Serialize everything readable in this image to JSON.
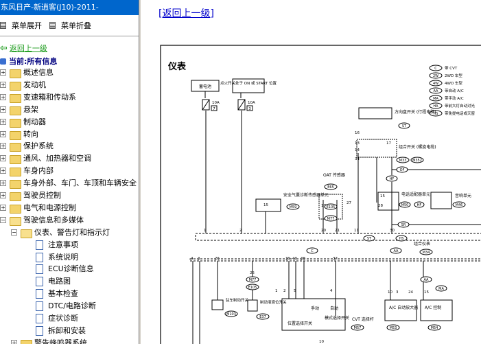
{
  "left_panel": {
    "title": "东风日产-新逍客(J10)-2011-",
    "menu": {
      "expand_label": "菜单展开",
      "collapse_label": "菜单折叠"
    },
    "back_label": "返回上一级",
    "current_label": "当前:所有信息",
    "tree": [
      {
        "label": "概述信息",
        "level": 0,
        "type": "folder"
      },
      {
        "label": "发动机",
        "level": 0,
        "type": "folder"
      },
      {
        "label": "变速箱和传动系",
        "level": 0,
        "type": "folder"
      },
      {
        "label": "悬架",
        "level": 0,
        "type": "folder"
      },
      {
        "label": "制动器",
        "level": 0,
        "type": "folder"
      },
      {
        "label": "转向",
        "level": 0,
        "type": "folder"
      },
      {
        "label": "保护系统",
        "level": 0,
        "type": "folder"
      },
      {
        "label": "通风、加热器和空调",
        "level": 0,
        "type": "folder"
      },
      {
        "label": "车身内部",
        "level": 0,
        "type": "folder"
      },
      {
        "label": "车身外部、车门、车顶和车辆安全",
        "level": 0,
        "type": "folder"
      },
      {
        "label": "驾驶员控制",
        "level": 0,
        "type": "folder"
      },
      {
        "label": "电气和电源控制",
        "level": 0,
        "type": "folder"
      },
      {
        "label": "驾驶信息和多媒体",
        "level": 0,
        "type": "folder-open"
      },
      {
        "label": "仪表、警告灯和指示灯",
        "level": 1,
        "type": "folder-open"
      },
      {
        "label": "注意事项",
        "level": 2,
        "type": "doc"
      },
      {
        "label": "系统说明",
        "level": 2,
        "type": "doc"
      },
      {
        "label": "ECU诊断信息",
        "level": 2,
        "type": "doc"
      },
      {
        "label": "电路图",
        "level": 2,
        "type": "doc",
        "selected": true
      },
      {
        "label": "基本检查",
        "level": 2,
        "type": "doc"
      },
      {
        "label": "DTC/电路诊断",
        "level": 2,
        "type": "doc"
      },
      {
        "label": "症状诊断",
        "level": 2,
        "type": "doc"
      },
      {
        "label": "拆卸和安装",
        "level": 2,
        "type": "doc"
      },
      {
        "label": "警告蜂鸣器系统",
        "level": 1,
        "type": "folder"
      }
    ]
  },
  "right_panel": {
    "back_link": "[返回上一级]",
    "diagram": {
      "title": "仪表",
      "legend": [
        {
          "code": "C",
          "text": "带 CVT"
        },
        {
          "code": "2W",
          "text": "2WD 车型"
        },
        {
          "code": "4W",
          "text": "4WD 车型"
        },
        {
          "code": "AA",
          "text": "带自动 A/C"
        },
        {
          "code": "MA",
          "text": "带手动 A/C"
        },
        {
          "code": "HA",
          "text": "带前大灯自动对光"
        },
        {
          "code": "HS",
          "text": "带免提电话或天窗"
        }
      ],
      "battery": "蓄电池",
      "ign_switch": "点火开关处于 ON 或 START 位置",
      "fuse1": "10A",
      "fuse1_no": "7",
      "fuse2": "10A",
      "fuse2_no": "3",
      "steering_switch": "方向盘开关 (行程电脑)",
      "steering_tag": "ST",
      "combo_switch": "组合开关 (螺旋电缆)",
      "combo_conn_1": "M33",
      "combo_conn_2": "M352",
      "oat_sensor": "OAT 传感器",
      "oat_conn": "E65",
      "conn_e105": "E105",
      "conn_m77": "M77",
      "airbag_unit": "安全气囊诊断传感器单元",
      "airbag_conn": "M59",
      "power_unit": "电话适配器单元",
      "power_conn": "M50",
      "power_tag": "HF",
      "audio_unit": "音响单元",
      "audio_conn": "M46",
      "combo_meter": "组合仪表",
      "combo_meter_conn": "M34",
      "pkb_switch": "驻车制动开关",
      "pkb_conn": "M103",
      "brake_fluid": "制动液液位开关",
      "brake_fluid_conn": "E37",
      "pos_switch": "位置选择开关",
      "mode_manual": "手动",
      "mode_auto": "自动",
      "mode_switch": "模式选择开关",
      "cvt_unit": "CVT 选择杆",
      "cvt_conn": "M57",
      "auto_ac": "A/C 自动放大器",
      "auto_ac_conn": "M53",
      "ac_ctrl": "A/C 控制",
      "ac_ctrl_conn": "M54",
      "tags": {
        "OF": "OF",
        "HF": "HF",
        "SR": "SR",
        "ST": "ST",
        "HS": "HS",
        "C": "C",
        "AA": "AA",
        "MA": "MA"
      },
      "pins": [
        "1",
        "2",
        "15",
        "20",
        "21",
        "11",
        "30",
        "4",
        "3",
        "26",
        "39",
        "40",
        "38",
        "37",
        "13",
        "17",
        "16",
        "14",
        "34",
        "15",
        "28",
        "10",
        "3",
        "24",
        "15",
        "25",
        "27",
        "17",
        "3",
        "4",
        "5",
        "2",
        "1",
        "10",
        "4"
      ]
    }
  }
}
